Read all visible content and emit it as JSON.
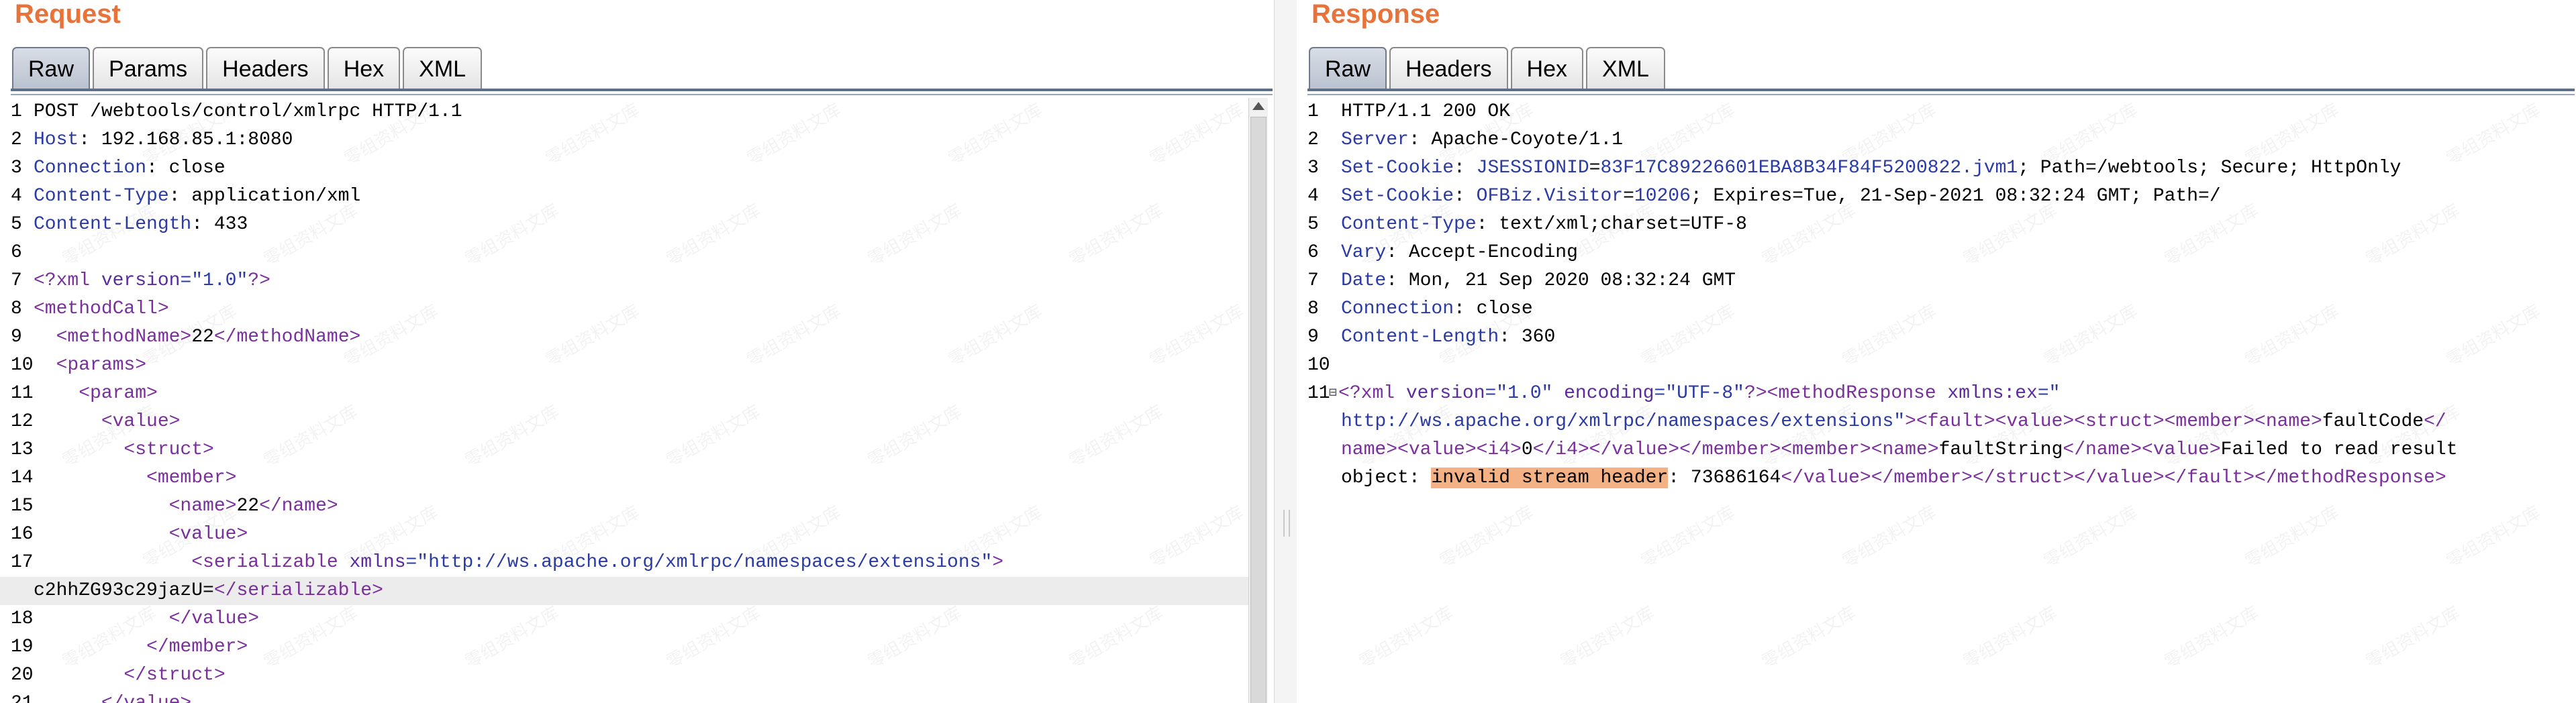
{
  "colors": {
    "title": "#e8733a",
    "tab_active": "#b9c2cf",
    "highlight": "#f4b183",
    "keyword": "#2a3aa6",
    "tag": "#7a2f9c"
  },
  "request": {
    "title": "Request",
    "tabs": [
      "Raw",
      "Params",
      "Headers",
      "Hex",
      "XML"
    ],
    "active_tab": "Raw",
    "lines": [
      {
        "n": "1",
        "segs": [
          {
            "t": "POST /webtools/control/xmlrpc HTTP/1.1",
            "c": ""
          }
        ]
      },
      {
        "n": "2",
        "segs": [
          {
            "t": "Host",
            "c": "k"
          },
          {
            "t": ": 192.168.85.1:8080",
            "c": ""
          }
        ]
      },
      {
        "n": "3",
        "segs": [
          {
            "t": "Connection",
            "c": "k"
          },
          {
            "t": ": close",
            "c": ""
          }
        ]
      },
      {
        "n": "4",
        "segs": [
          {
            "t": "Content-Type",
            "c": "k"
          },
          {
            "t": ": application/xml",
            "c": ""
          }
        ]
      },
      {
        "n": "5",
        "segs": [
          {
            "t": "Content-Length",
            "c": "k"
          },
          {
            "t": ": 433",
            "c": ""
          }
        ]
      },
      {
        "n": "6",
        "segs": []
      },
      {
        "n": "7",
        "segs": [
          {
            "t": "<?xml ",
            "c": "tagc"
          },
          {
            "t": "version",
            "c": "attr"
          },
          {
            "t": "=\"1.0\"",
            "c": "str"
          },
          {
            "t": "?>",
            "c": "tagc"
          }
        ]
      },
      {
        "n": "8",
        "segs": [
          {
            "t": "<methodCall>",
            "c": "tagc"
          }
        ]
      },
      {
        "n": "9",
        "segs": [
          {
            "t": "  <methodName>",
            "c": "tagc"
          },
          {
            "t": "22",
            "c": ""
          },
          {
            "t": "</methodName>",
            "c": "tagc"
          }
        ]
      },
      {
        "n": "10",
        "segs": [
          {
            "t": "  <params>",
            "c": "tagc"
          }
        ]
      },
      {
        "n": "11",
        "segs": [
          {
            "t": "    <param>",
            "c": "tagc"
          }
        ]
      },
      {
        "n": "12",
        "segs": [
          {
            "t": "      <value>",
            "c": "tagc"
          }
        ]
      },
      {
        "n": "13",
        "segs": [
          {
            "t": "        <struct>",
            "c": "tagc"
          }
        ]
      },
      {
        "n": "14",
        "segs": [
          {
            "t": "          <member>",
            "c": "tagc"
          }
        ]
      },
      {
        "n": "15",
        "segs": [
          {
            "t": "            <name>",
            "c": "tagc"
          },
          {
            "t": "22",
            "c": ""
          },
          {
            "t": "</name>",
            "c": "tagc"
          }
        ]
      },
      {
        "n": "16",
        "segs": [
          {
            "t": "            <value>",
            "c": "tagc"
          }
        ]
      },
      {
        "n": "17",
        "segs": [
          {
            "t": "              <serializable ",
            "c": "tagc"
          },
          {
            "t": "xmlns",
            "c": "attr"
          },
          {
            "t": "=\"http://ws.apache.org/xmlrpc/namespaces/extensions\"",
            "c": "str"
          },
          {
            "t": ">",
            "c": "tagc"
          }
        ]
      },
      {
        "n": "",
        "cont": true,
        "segs": [
          {
            "t": "c2hhZG93c29jazU=",
            "c": ""
          },
          {
            "t": "</serializable>",
            "c": "tagc"
          }
        ]
      },
      {
        "n": "18",
        "segs": [
          {
            "t": "            </value>",
            "c": "tagc"
          }
        ]
      },
      {
        "n": "19",
        "segs": [
          {
            "t": "          </member>",
            "c": "tagc"
          }
        ]
      },
      {
        "n": "20",
        "segs": [
          {
            "t": "        </struct>",
            "c": "tagc"
          }
        ]
      },
      {
        "n": "21",
        "segs": [
          {
            "t": "      </value>",
            "c": "tagc"
          }
        ]
      }
    ]
  },
  "response": {
    "title": "Response",
    "tabs": [
      "Raw",
      "Headers",
      "Hex",
      "XML"
    ],
    "active_tab": "Raw",
    "lines": [
      {
        "n": "1",
        "segs": [
          {
            "t": "HTTP/1.1 200 OK",
            "c": ""
          }
        ]
      },
      {
        "n": "2",
        "segs": [
          {
            "t": "Server",
            "c": "k"
          },
          {
            "t": ": Apache-Coyote/1.1",
            "c": ""
          }
        ]
      },
      {
        "n": "3",
        "segs": [
          {
            "t": "Set-Cookie",
            "c": "k"
          },
          {
            "t": ": ",
            "c": ""
          },
          {
            "t": "JSESSIONID",
            "c": "k"
          },
          {
            "t": "=",
            "c": ""
          },
          {
            "t": "83F17C89226601EBA8B34F84F5200822.jvm1",
            "c": "k"
          },
          {
            "t": "; Path=/webtools; Secure; HttpOnly",
            "c": ""
          }
        ]
      },
      {
        "n": "4",
        "segs": [
          {
            "t": "Set-Cookie",
            "c": "k"
          },
          {
            "t": ": ",
            "c": ""
          },
          {
            "t": "OFBiz.Visitor",
            "c": "k"
          },
          {
            "t": "=",
            "c": ""
          },
          {
            "t": "10206",
            "c": "k"
          },
          {
            "t": "; Expires=Tue, 21-Sep-2021 08:32:24 GMT; Path=/",
            "c": ""
          }
        ]
      },
      {
        "n": "5",
        "segs": [
          {
            "t": "Content-Type",
            "c": "k"
          },
          {
            "t": ": text/xml;charset=UTF-8",
            "c": ""
          }
        ]
      },
      {
        "n": "6",
        "segs": [
          {
            "t": "Vary",
            "c": "k"
          },
          {
            "t": ": Accept-Encoding",
            "c": ""
          }
        ]
      },
      {
        "n": "7",
        "segs": [
          {
            "t": "Date",
            "c": "k"
          },
          {
            "t": ": Mon, 21 Sep 2020 08:32:24 GMT",
            "c": ""
          }
        ]
      },
      {
        "n": "8",
        "segs": [
          {
            "t": "Connection",
            "c": "k"
          },
          {
            "t": ": close",
            "c": ""
          }
        ]
      },
      {
        "n": "9",
        "segs": [
          {
            "t": "Content-Length",
            "c": "k"
          },
          {
            "t": ": 360",
            "c": ""
          }
        ]
      },
      {
        "n": "10",
        "segs": []
      },
      {
        "n": "11",
        "fold": true,
        "segs": [
          {
            "t": "<?xml ",
            "c": "tagc"
          },
          {
            "t": "version",
            "c": "attr"
          },
          {
            "t": "=\"1.0\" ",
            "c": "str"
          },
          {
            "t": "encoding",
            "c": "attr"
          },
          {
            "t": "=\"UTF-8\"",
            "c": "str"
          },
          {
            "t": "?><methodResponse ",
            "c": "tagc"
          },
          {
            "t": "xmlns:ex",
            "c": "attr"
          },
          {
            "t": "=\"",
            "c": "str"
          }
        ]
      },
      {
        "n": "",
        "segs": [
          {
            "t": "http://ws.apache.org/xmlrpc/namespaces/extensions\"",
            "c": "str"
          },
          {
            "t": "><fault><value><struct><member><name>",
            "c": "tagc"
          },
          {
            "t": "faultCode",
            "c": ""
          },
          {
            "t": "</",
            "c": "tagc"
          }
        ]
      },
      {
        "n": "",
        "segs": [
          {
            "t": "name><value><i4>",
            "c": "tagc"
          },
          {
            "t": "0",
            "c": ""
          },
          {
            "t": "</i4></value></member><member><name>",
            "c": "tagc"
          },
          {
            "t": "faultString",
            "c": ""
          },
          {
            "t": "</name><value>",
            "c": "tagc"
          },
          {
            "t": "Failed to read result",
            "c": ""
          }
        ]
      },
      {
        "n": "",
        "segs": [
          {
            "t": "object: ",
            "c": ""
          },
          {
            "t": "invalid stream header",
            "c": "hl"
          },
          {
            "t": ": 73686164",
            "c": ""
          },
          {
            "t": "</value></member></struct></value></fault></methodResponse>",
            "c": "tagc"
          }
        ]
      }
    ]
  },
  "watermark_text": "零组资料文库"
}
